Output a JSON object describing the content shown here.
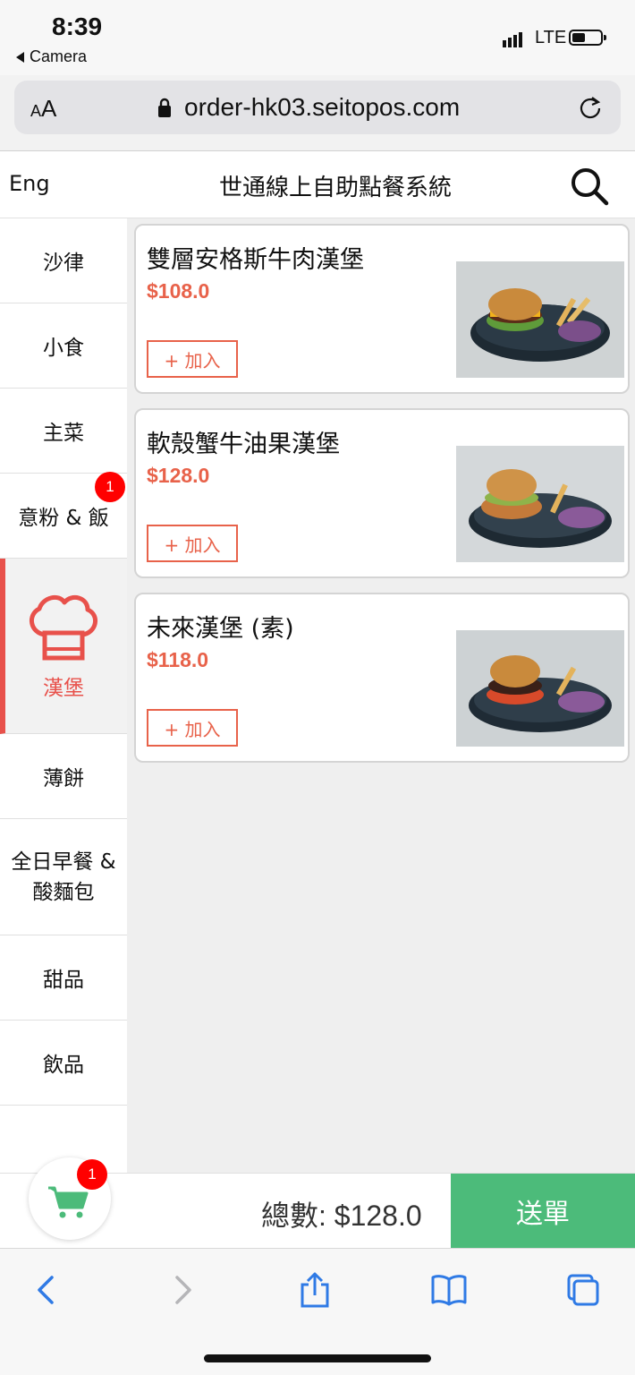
{
  "status_bar": {
    "time": "8:39",
    "back_app": "Camera",
    "network": "LTE",
    "icons": [
      "signal-icon",
      "battery-icon"
    ]
  },
  "browser": {
    "text_size_label_small": "A",
    "text_size_label_large": "A",
    "url": "order-hk03.seitopos.com",
    "icons": [
      "lock-icon",
      "reload-icon"
    ]
  },
  "header": {
    "lang_toggle": "Eng",
    "title": "世通線上自助點餐系統",
    "icons": [
      "search-icon"
    ]
  },
  "sidebar": {
    "items": [
      {
        "label": "沙律"
      },
      {
        "label": "小食"
      },
      {
        "label": "主菜"
      },
      {
        "label": "意粉 & 飯",
        "badge": "1"
      },
      {
        "label": "漢堡",
        "active": true,
        "icon": "chef-hat-icon"
      },
      {
        "label": "薄餅"
      },
      {
        "label_line1": "全日早餐 &",
        "label_line2": "酸麵包"
      },
      {
        "label": "甜品"
      },
      {
        "label": "飲品"
      }
    ]
  },
  "menu_items": [
    {
      "name": "雙層安格斯牛肉漢堡",
      "price": "$108.0",
      "add_label": "+ 加入"
    },
    {
      "name": "軟殼蟹牛油果漢堡",
      "price": "$128.0",
      "add_label": "+ 加入"
    },
    {
      "name": "未來漢堡 (素)",
      "price": "$118.0",
      "add_label": "+ 加入"
    }
  ],
  "cart": {
    "badge": "1",
    "total_label": "總數: $128.0",
    "submit_label": "送單",
    "icons": [
      "cart-icon"
    ]
  },
  "colors": {
    "accent": "#e8514b",
    "price": "#e8624a",
    "submit": "#4cbb7a",
    "badge": "#ff0000",
    "ios_blue": "#2f7ae5"
  },
  "toolbar": {
    "icons": [
      "back-icon",
      "forward-icon",
      "share-icon",
      "bookmarks-icon",
      "tabs-icon"
    ]
  }
}
